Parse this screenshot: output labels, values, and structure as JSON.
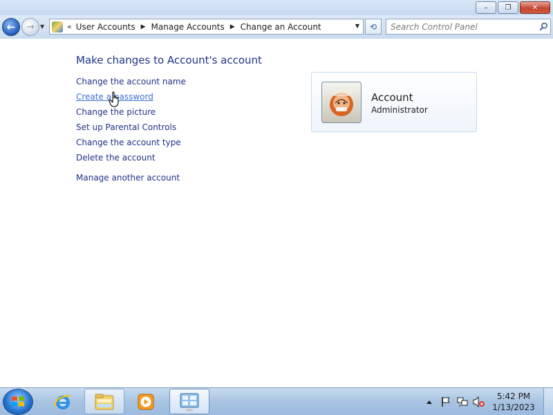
{
  "window": {
    "minimize_label": "–",
    "maximize_label": "❐",
    "close_label": "✕"
  },
  "nav": {
    "back_glyph": "←",
    "forward_glyph": "→",
    "overflow_glyph": "«",
    "breadcrumbs": [
      {
        "label": "User Accounts"
      },
      {
        "label": "Manage Accounts"
      },
      {
        "label": "Change an Account"
      }
    ],
    "separator_glyph": "▶",
    "dropdown_glyph": "▼",
    "refresh_glyph": "⟲",
    "search": {
      "placeholder": "Search Control Panel",
      "value": ""
    }
  },
  "main": {
    "title": "Make changes to Account's account",
    "tasks": [
      {
        "label": "Change the account name"
      },
      {
        "label": "Create a password"
      },
      {
        "label": "Change the picture"
      },
      {
        "label": "Set up Parental Controls"
      },
      {
        "label": "Change the account type"
      },
      {
        "label": "Delete the account"
      }
    ],
    "other_task": {
      "label": "Manage another account"
    }
  },
  "account": {
    "name": "Account",
    "role": "Administrator",
    "picture_icon": "user-picture-icon"
  },
  "taskbar": {
    "items": [
      {
        "icon": "internet-explorer-icon"
      },
      {
        "icon": "windows-explorer-icon"
      },
      {
        "icon": "media-player-icon"
      },
      {
        "icon": "control-panel-icon"
      }
    ],
    "clock": {
      "time": "5:42 PM",
      "date": "1/13/2023"
    }
  },
  "colors": {
    "link": "#1e3287",
    "link_hover": "#3a6fd1",
    "taskbar": "#a9c4e2"
  }
}
